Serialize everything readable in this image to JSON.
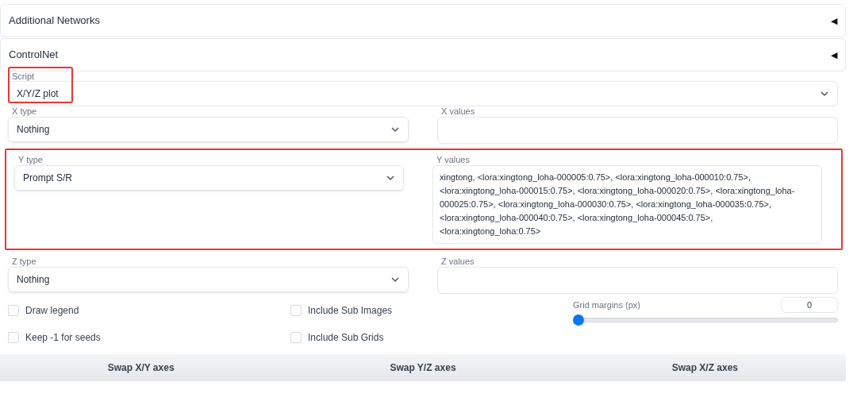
{
  "accordions": [
    {
      "title": "Additional Networks",
      "arrow": "◀"
    },
    {
      "title": "ControlNet",
      "arrow": "◀"
    }
  ],
  "script": {
    "label": "Script",
    "value": "X/Y/Z plot",
    "highlighted": true
  },
  "axes": [
    {
      "type_label": "X type",
      "type_value": "Nothing",
      "values_label": "X values",
      "highlighted": false
    },
    {
      "type_label": "Y type",
      "type_value": "Prompt S/R",
      "values_label": "Y values",
      "values": "xingtong, <lora:xingtong_loha-000005:0.75>, <lora:xingtong_loha-000010:0.75>, <lora:xingtong_loha-000015:0.75>, <lora:xingtong_loha-000020:0.75>, <lora:xingtong_loha-000025:0.75>, <lora:xingtong_loha-000030:0.75>, <lora:xingtong_loha-000035:0.75>, <lora:xingtong_loha-000040:0.75>, <lora:xingtong_loha-000045:0.75>, <lora:xingtong_loha:0.75>",
      "highlighted": true
    },
    {
      "type_label": "Z type",
      "type_value": "Nothing",
      "values_label": "Z values",
      "highlighted": false
    }
  ],
  "checkboxes": [
    {
      "label": "Draw legend",
      "checked": false
    },
    {
      "label": "Include Sub Images",
      "checked": false
    },
    {
      "label": "Keep -1 for seeds",
      "checked": false
    },
    {
      "label": "Include Sub Grids",
      "checked": false
    }
  ],
  "grid_margins": {
    "label": "Grid margins (px)",
    "value": "0",
    "level": 0
  },
  "buttons": [
    "Swap X/Y axes",
    "Swap Y/Z axes",
    "Swap X/Z axes"
  ]
}
